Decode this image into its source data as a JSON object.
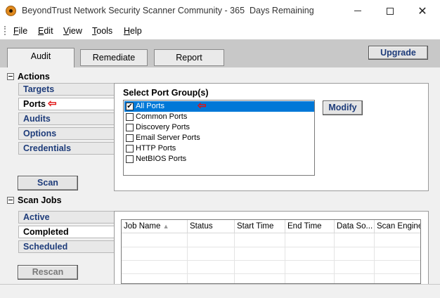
{
  "window": {
    "title": "BeyondTrust Network Security Scanner Community - 365  Days Remaining",
    "minimize": "—",
    "close": "✕"
  },
  "menu": {
    "file": {
      "u": "F",
      "rest": "ile"
    },
    "edit": {
      "u": "E",
      "rest": "dit"
    },
    "view": {
      "u": "V",
      "rest": "iew"
    },
    "tools": {
      "u": "T",
      "rest": "ools"
    },
    "help": {
      "u": "H",
      "rest": "elp"
    }
  },
  "tabs": {
    "audit": "Audit",
    "remediate": "Remediate",
    "report": "Report",
    "active": "audit"
  },
  "upgrade_label": "Upgrade",
  "actions": {
    "header": "Actions",
    "items": [
      "Targets",
      "Ports",
      "Audits",
      "Options",
      "Credentials"
    ],
    "selected": "Ports",
    "scan_label": "Scan"
  },
  "ports": {
    "label": "Select Port Group(s)",
    "modify_label": "Modify",
    "groups": [
      {
        "name": "All Ports",
        "checked": true,
        "selected": true
      },
      {
        "name": "Common Ports",
        "checked": false
      },
      {
        "name": "Discovery Ports",
        "checked": false
      },
      {
        "name": "Email Server Ports",
        "checked": false
      },
      {
        "name": "HTTP Ports",
        "checked": false
      },
      {
        "name": "NetBIOS Ports",
        "checked": false
      }
    ]
  },
  "scan_jobs": {
    "header": "Scan Jobs",
    "items": [
      "Active",
      "Completed",
      "Scheduled"
    ],
    "selected": "Completed",
    "rescan_label": "Rescan",
    "columns": [
      "Job Name",
      "Status",
      "Start Time",
      "End Time",
      "Data So...",
      "Scan Engine"
    ],
    "sort_indicator": "▲"
  },
  "annotations": {
    "arrow": "⇦",
    "arrow_color": "#e01010"
  },
  "colors": {
    "accent_text": "#1e3c7a",
    "selection": "#0078d7"
  }
}
